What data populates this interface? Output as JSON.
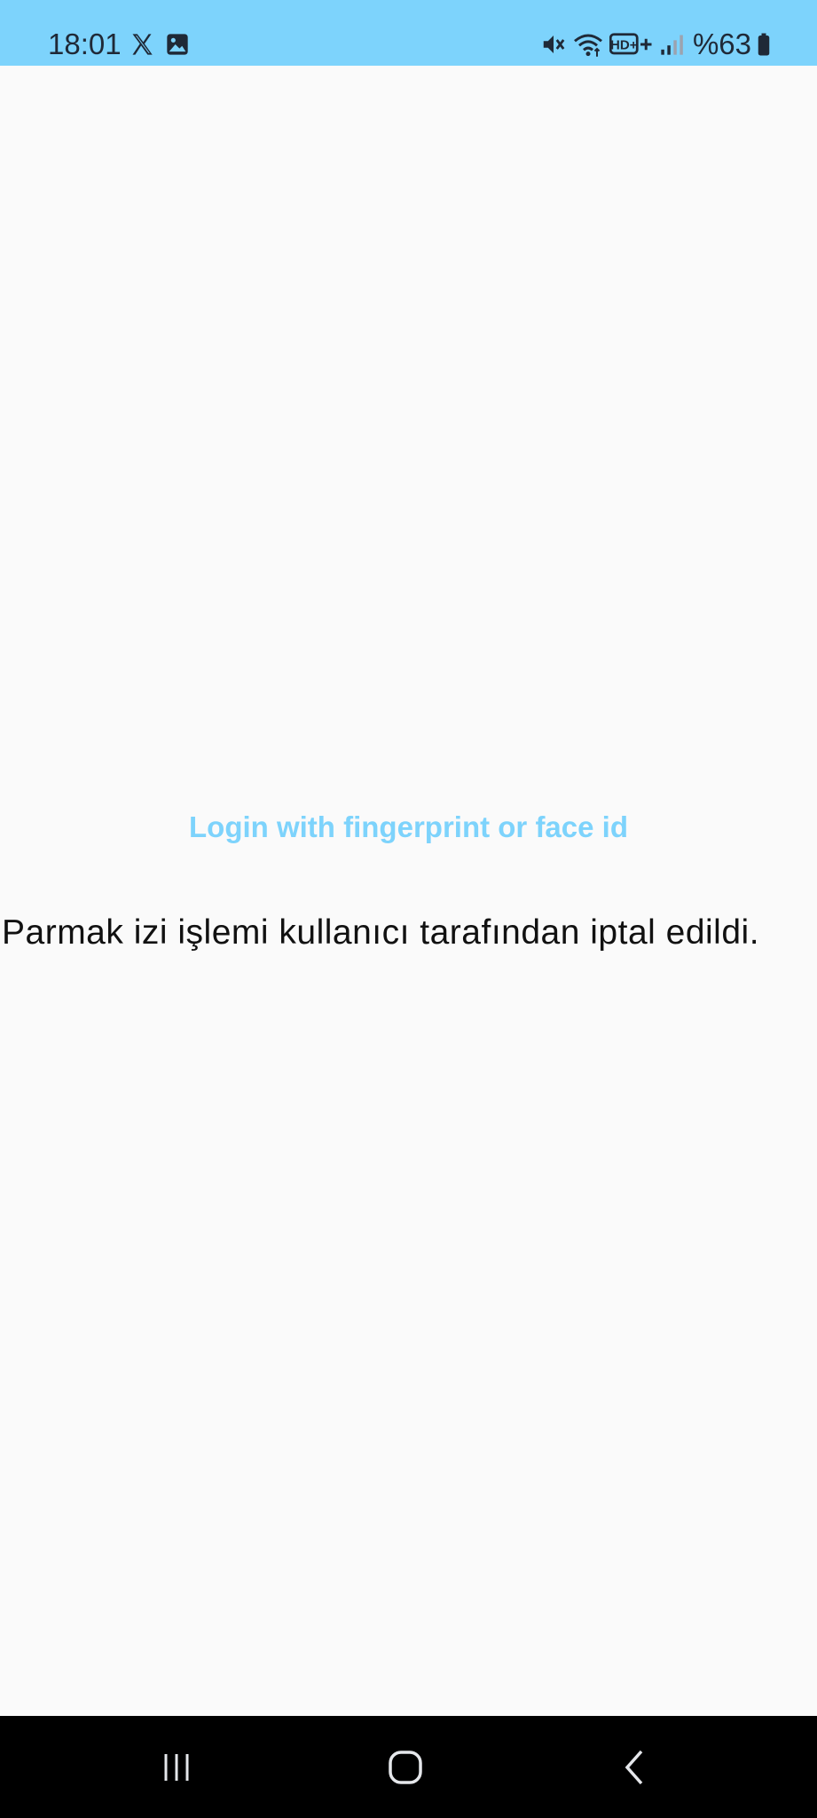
{
  "status_bar": {
    "time": "18:01",
    "battery_text": "%63",
    "background_color": "#7dd3fc",
    "left_icons": [
      "x-logo-icon",
      "gallery-icon"
    ],
    "right_icons": [
      "mute-icon",
      "wifi-icon",
      "hd-plus-icon",
      "signal-icon",
      "battery-icon"
    ],
    "hd_label": "HD+"
  },
  "main": {
    "login_link_label": "Login with fingerprint or face id",
    "login_link_color": "#7dd3fc",
    "message": "Parmak izi işlemi kullanıcı tarafından iptal edildi."
  },
  "nav_bar": {
    "buttons": [
      "recent-apps-icon",
      "home-icon",
      "back-icon"
    ]
  }
}
